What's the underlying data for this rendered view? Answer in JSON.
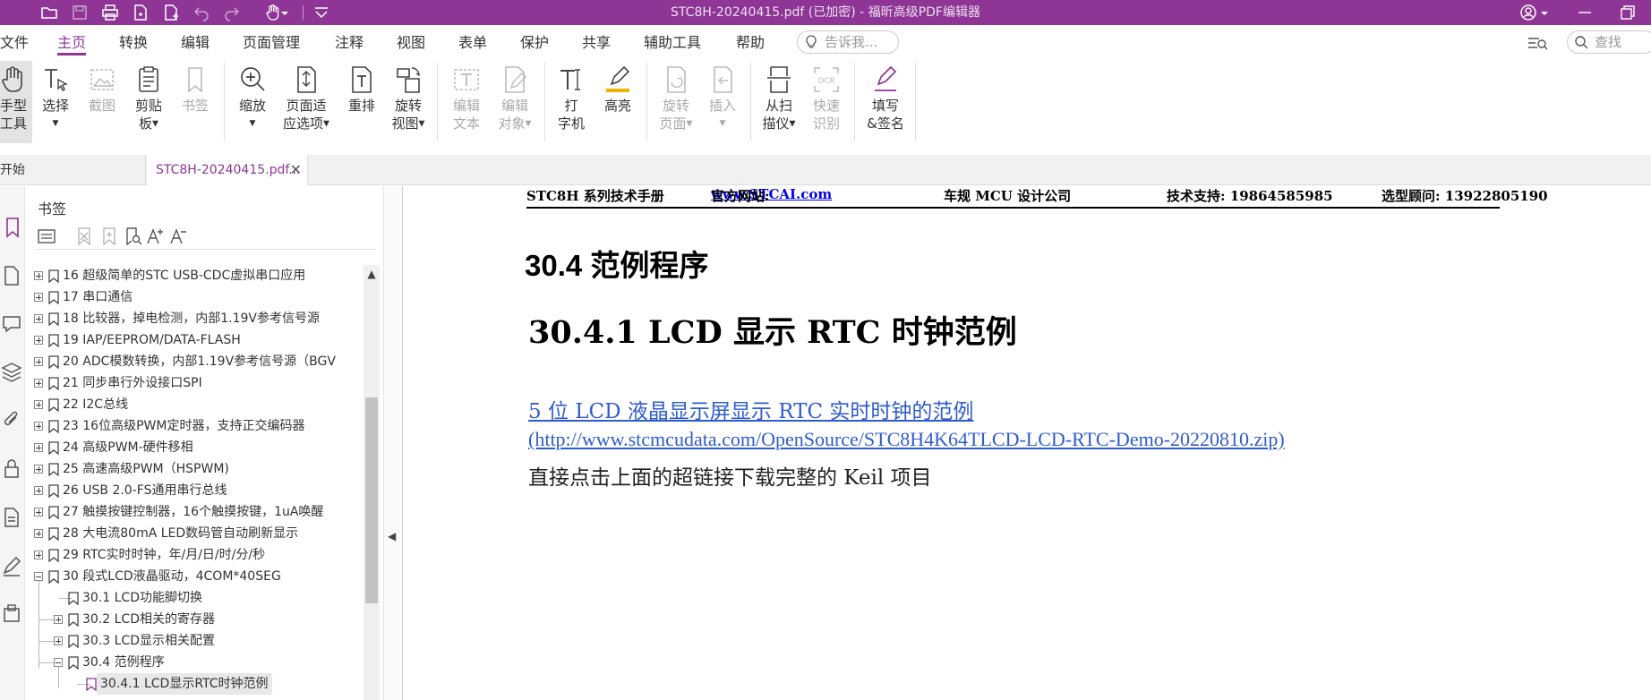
{
  "window": {
    "title": "STC8H-20240415.pdf (已加密) - 福昕高级PDF编辑器"
  },
  "menu": {
    "tabs": [
      {
        "label": "文件"
      },
      {
        "label": "主页",
        "active": true
      },
      {
        "label": "转换"
      },
      {
        "label": "编辑"
      },
      {
        "label": "页面管理"
      },
      {
        "label": "注释"
      },
      {
        "label": "视图"
      },
      {
        "label": "表单"
      },
      {
        "label": "保护"
      },
      {
        "label": "共享"
      },
      {
        "label": "辅助工具"
      },
      {
        "label": "帮助"
      }
    ],
    "tell_me_placeholder": "告诉我...",
    "search_placeholder": "查找"
  },
  "ribbon": {
    "hand_tool": [
      "手型",
      "工具"
    ],
    "select": "选择",
    "snapshot": "截图",
    "clipboard": [
      "剪贴",
      "板"
    ],
    "bookmark": "书签",
    "zoom": "缩放",
    "fit_page": [
      "页面适",
      "应选项"
    ],
    "reflow": "重排",
    "rotate_view": [
      "旋转",
      "视图"
    ],
    "edit_text": [
      "编辑",
      "文本"
    ],
    "edit_object": [
      "编辑",
      "对象"
    ],
    "typewriter": [
      "打",
      "字机"
    ],
    "highlight": "高亮",
    "rotate_page": [
      "旋转",
      "页面"
    ],
    "insert": "插入",
    "from_scanner": [
      "从扫",
      "描仪"
    ],
    "quick_ocr": [
      "快速",
      "识别"
    ],
    "fill_sign": [
      "填写",
      "&签名"
    ]
  },
  "doc_tabs": {
    "start": "开始",
    "document": "STC8H-20240415.pdf..."
  },
  "bookmarks": {
    "header": "书签",
    "items": [
      {
        "label": "16  超级简单的STC USB-CDC虚拟串口应用",
        "level": 0,
        "expand": "plus"
      },
      {
        "label": "17  串口通信",
        "level": 0,
        "expand": "plus"
      },
      {
        "label": "18  比较器，掉电检测，内部1.19V参考信号源",
        "level": 0,
        "expand": "plus"
      },
      {
        "label": "19  IAP/EEPROM/DATA-FLASH",
        "level": 0,
        "expand": "plus"
      },
      {
        "label": "20  ADC模数转换，内部1.19V参考信号源（BGV",
        "level": 0,
        "expand": "plus"
      },
      {
        "label": "21  同步串行外设接口SPI",
        "level": 0,
        "expand": "plus"
      },
      {
        "label": "22  I2C总线",
        "level": 0,
        "expand": "plus"
      },
      {
        "label": "23  16位高级PWM定时器，支持正交编码器",
        "level": 0,
        "expand": "plus"
      },
      {
        "label": "24  高级PWM-硬件移相",
        "level": 0,
        "expand": "plus"
      },
      {
        "label": "25  高速高级PWM（HSPWM)",
        "level": 0,
        "expand": "plus"
      },
      {
        "label": "26  USB 2.0-FS通用串行总线",
        "level": 0,
        "expand": "plus"
      },
      {
        "label": "27  触摸按键控制器，16个触摸按键，1uA唤醒",
        "level": 0,
        "expand": "plus"
      },
      {
        "label": "28  大电流80mA  LED数码管自动刷新显示",
        "level": 0,
        "expand": "plus"
      },
      {
        "label": "29  RTC实时时钟，年/月/日/时/分/秒",
        "level": 0,
        "expand": "plus"
      },
      {
        "label": "30  段式LCD液晶驱动，4COM*40SEG",
        "level": 0,
        "expand": "minus"
      },
      {
        "label": "30.1  LCD功能脚切换",
        "level": 1,
        "expand": "none"
      },
      {
        "label": "30.2  LCD相关的寄存器",
        "level": 1,
        "expand": "plus"
      },
      {
        "label": "30.3 LCD显示相关配置",
        "level": 1,
        "expand": "plus"
      },
      {
        "label": "30.4  范例程序",
        "level": 1,
        "expand": "minus"
      },
      {
        "label": "30.4.1 LCD显示RTC时钟范例",
        "level": 2,
        "expand": "none",
        "selected": true
      }
    ]
  },
  "document": {
    "header": {
      "manual": "STC8H 系列技术手册",
      "site_label": "官方网站: ",
      "site_link": "www.STCAI.com",
      "company": "车规 MCU 设计公司",
      "support": "技术支持: 19864585985",
      "consult": "选型顾问: 13922805190"
    },
    "section_title": "30.4 范例程序",
    "subsection_title": "30.4.1  LCD 显示 RTC 时钟范例",
    "link_text": "5 位 LCD 液晶显示屏显示 RTC 实时时钟的范例",
    "link_url": "(http://www.stcmcudata.com/OpenSource/STC8H4K64TLCD-LCD-RTC-Demo-20220810.zip)",
    "paragraph": "直接点击上面的超链接下载完整的 Keil 项目"
  },
  "colors": {
    "brand": "#8e3596",
    "link": "#2f5ccc"
  }
}
